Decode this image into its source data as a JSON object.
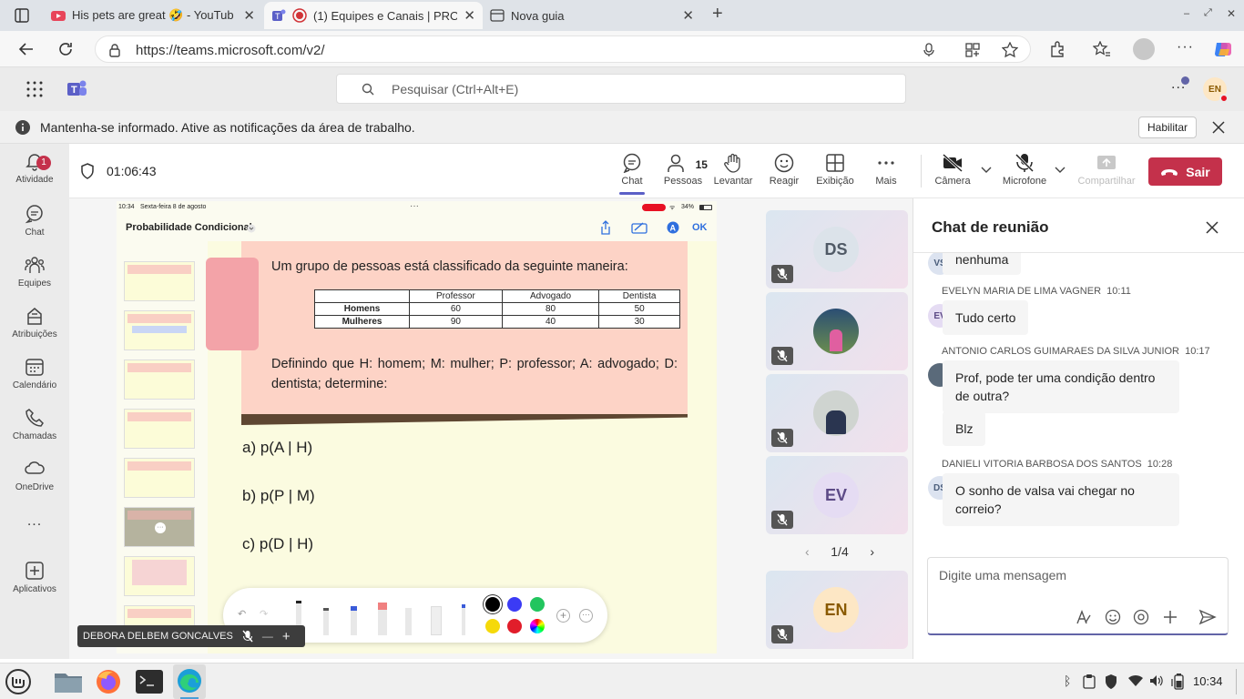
{
  "browser": {
    "tabs": [
      {
        "title": "His pets are great 🤣 - YouTub",
        "close": "✕"
      },
      {
        "title": "(1) Equipes e Canais | PRO",
        "close": "✕"
      },
      {
        "title": "Nova guia",
        "close": "✕"
      }
    ],
    "new_tab": "+",
    "url": "https://teams.microsoft.com/v2/",
    "window_controls": [
      "–",
      "⤢",
      "✕"
    ],
    "profile_initials": "EN"
  },
  "teams": {
    "search_placeholder": "Pesquisar (Ctrl+Alt+E)",
    "more": "...",
    "user_initials": "EN",
    "notice": {
      "text": "Mantenha-se informado. Ative as notificações da área de trabalho.",
      "enable_label": "Habilitar"
    }
  },
  "rail": [
    {
      "label": "Atividade",
      "icon": "bell-icon",
      "badge": "1"
    },
    {
      "label": "Chat",
      "icon": "chat-icon"
    },
    {
      "label": "Equipes",
      "icon": "teams-icon"
    },
    {
      "label": "Atribuições",
      "icon": "assignments-icon"
    },
    {
      "label": "Calendário",
      "icon": "calendar-icon"
    },
    {
      "label": "Chamadas",
      "icon": "phone-icon"
    },
    {
      "label": "OneDrive",
      "icon": "cloud-icon"
    },
    {
      "label": "",
      "icon": "more-icon",
      "glyph": "..."
    },
    {
      "label": "Aplicativos",
      "icon": "plus-icon"
    }
  ],
  "meeting": {
    "timer": "01:06:43",
    "controls": {
      "chat": "Chat",
      "people": "Pessoas",
      "people_count": "15",
      "raise": "Levantar",
      "react": "Reagir",
      "view": "Exibição",
      "more": "Mais",
      "camera": "Câmera",
      "mic": "Microfone",
      "share": "Compartilhar",
      "leave": "Sair"
    }
  },
  "ipad": {
    "status_time": "10:34",
    "status_date": "Sexta-feira 8 de agosto",
    "battery": "34%",
    "doc_title": "Probabilidade Condicional",
    "ok": "OK",
    "slide": {
      "intro": "Um grupo de pessoas está classificado da seguinte maneira:",
      "table": {
        "headers": [
          "",
          "Professor",
          "Advogado",
          "Dentista"
        ],
        "rows": [
          [
            "Homens",
            "60",
            "80",
            "50"
          ],
          [
            "Mulheres",
            "90",
            "40",
            "30"
          ]
        ]
      },
      "definition": "Definindo que H: homem; M: mulher; P: professor; A: advogado; D: dentista; determine:",
      "items": [
        "a) p(A | H)",
        "b) p(P | M)",
        "c) p(D | H)"
      ]
    },
    "presenter_name": "DEBORA DELBEM GONCALVES"
  },
  "tiles": {
    "ds": "DS",
    "ev": "EV",
    "en": "EN",
    "pager": "1/4"
  },
  "chat": {
    "title": "Chat de reunião",
    "messages": [
      {
        "initials": "VS",
        "text": "nenhuma"
      },
      {
        "author": "EVELYN MARIA DE LIMA VAGNER",
        "time": "10:11",
        "initials": "EV",
        "text": "Tudo certo"
      },
      {
        "author": "ANTONIO CARLOS GUIMARAES DA SILVA JUNIOR",
        "time": "10:17",
        "text": "Prof, pode ter uma condição dentro de outra?"
      },
      {
        "text": "Blz"
      },
      {
        "author": "DANIELI VITORIA BARBOSA DOS SANTOS",
        "time": "10:28",
        "initials": "DS",
        "text": "O sonho de valsa vai chegar no correio?"
      }
    ],
    "input_placeholder": "Digite uma mensagem"
  },
  "taskbar": {
    "time": "10:34"
  },
  "colors": {
    "accent": "#6264a7",
    "leave": "#c4314b",
    "presence_busy": "#e81123"
  }
}
